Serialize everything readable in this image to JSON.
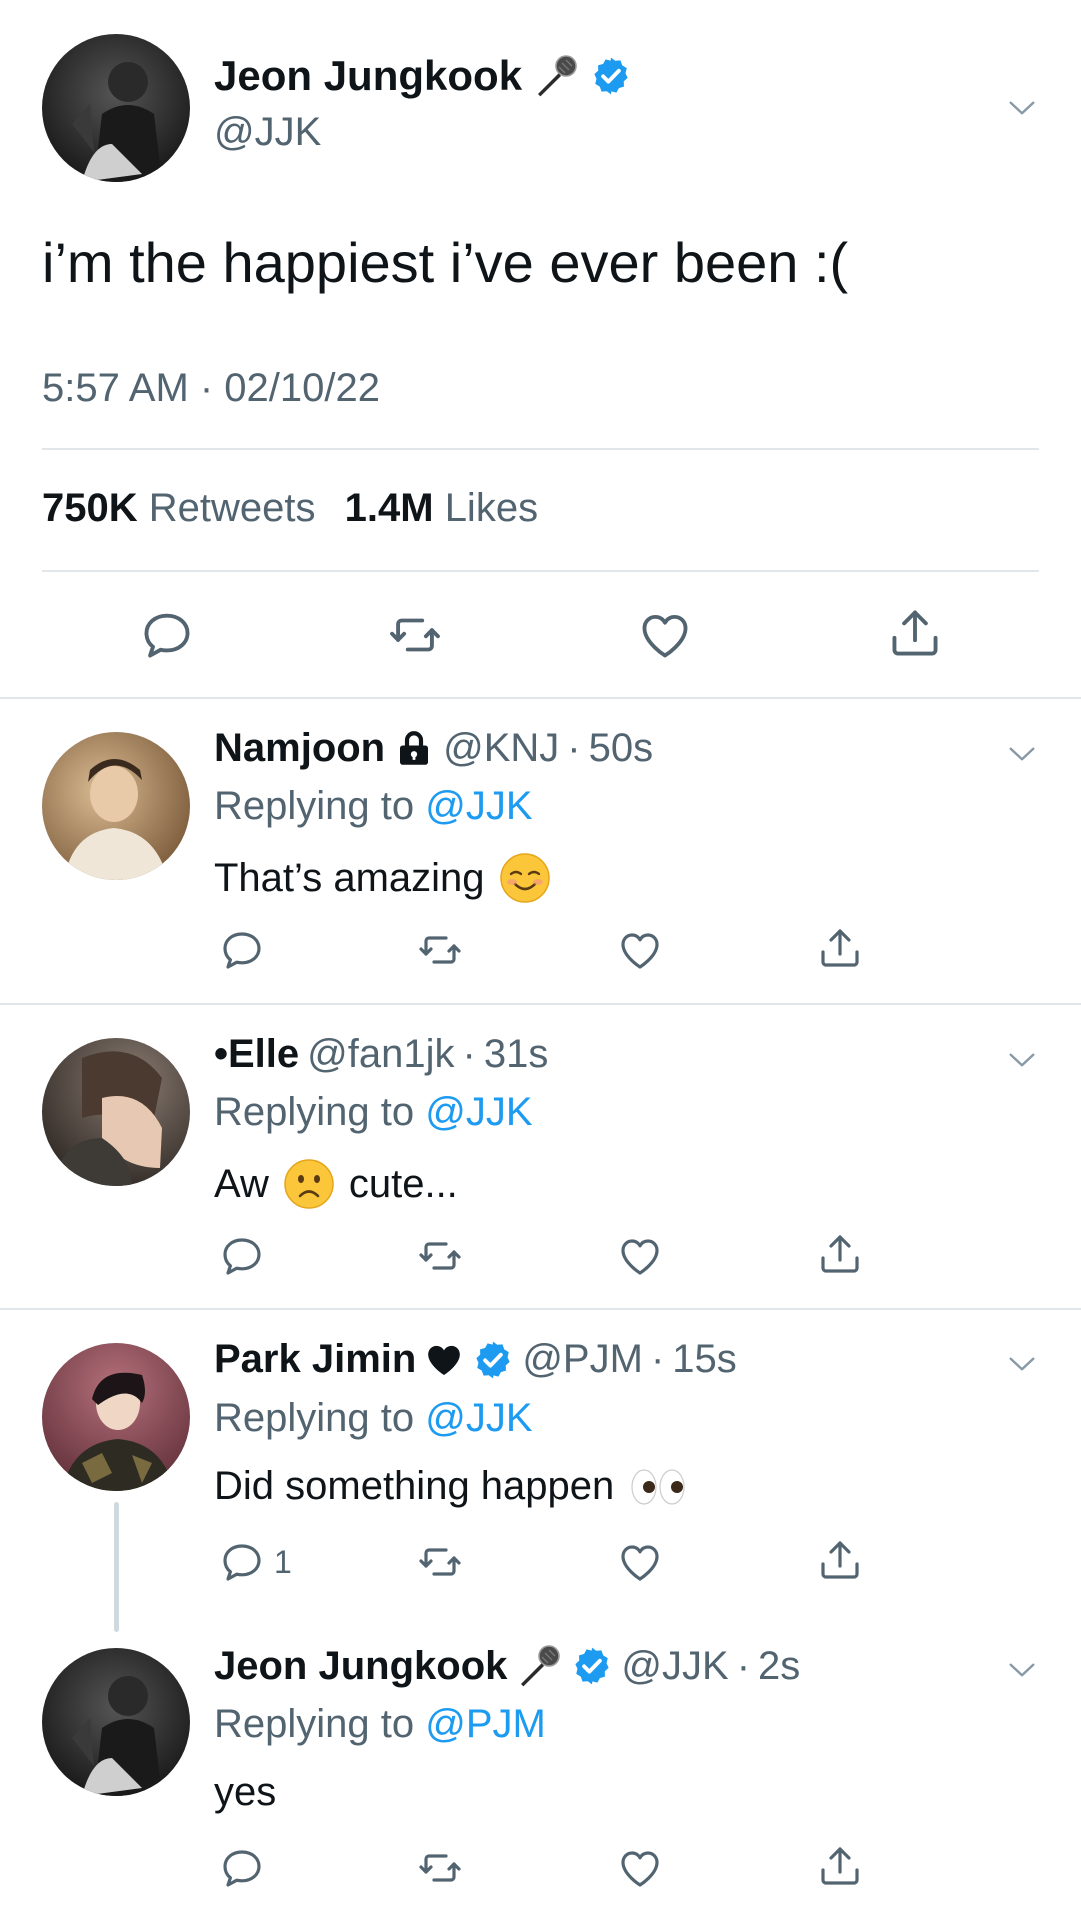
{
  "main_tweet": {
    "name": "Jeon Jungkook",
    "handle": "@JJK",
    "text": "i’m the happiest i’ve ever been :(",
    "timestamp": "5:57 AM · 02/10/22",
    "retweets_count": "750K",
    "retweets_label": "Retweets",
    "likes_count": "1.4M",
    "likes_label": "Likes",
    "name_icons": [
      "microphone-icon",
      "verified-badge-icon"
    ]
  },
  "replies": [
    {
      "name": "Namjoon",
      "name_icons": [
        "lock-icon"
      ],
      "handle": "@KNJ",
      "sep": "·",
      "time": "50s",
      "replying_prefix": "Replying to",
      "replying_to": "@JJK",
      "text": "That’s amazing",
      "text_emoji": "smiling-face-icon",
      "reply_count": ""
    },
    {
      "name": "•Elle",
      "name_icons": [],
      "handle": "@fan1jk",
      "sep": "·",
      "time": "31s",
      "replying_prefix": "Replying to",
      "replying_to": "@JJK",
      "text_before": "Aw",
      "text_emoji": "frowning-face-icon",
      "text_after": "cute...",
      "reply_count": ""
    },
    {
      "name": "Park Jimin",
      "name_icons": [
        "black-heart-icon",
        "verified-badge-icon"
      ],
      "handle": "@PJM",
      "sep": "·",
      "time": "15s",
      "replying_prefix": "Replying to",
      "replying_to": "@JJK",
      "text": "Did something happen",
      "text_emoji": "eyes-icon",
      "reply_count": "1"
    },
    {
      "name": "Jeon Jungkook",
      "name_icons": [
        "microphone-icon",
        "verified-badge-icon"
      ],
      "handle": "@JJK",
      "sep": "·",
      "time": "2s",
      "replying_prefix": "Replying to",
      "replying_to": "@PJM",
      "text": "yes",
      "reply_count": ""
    }
  ],
  "colors": {
    "text_primary": "#0f1419",
    "text_secondary": "#536471",
    "link_blue": "#1d9bf0",
    "divider": "#e1e6ea",
    "thread_line": "#cfd9de"
  }
}
